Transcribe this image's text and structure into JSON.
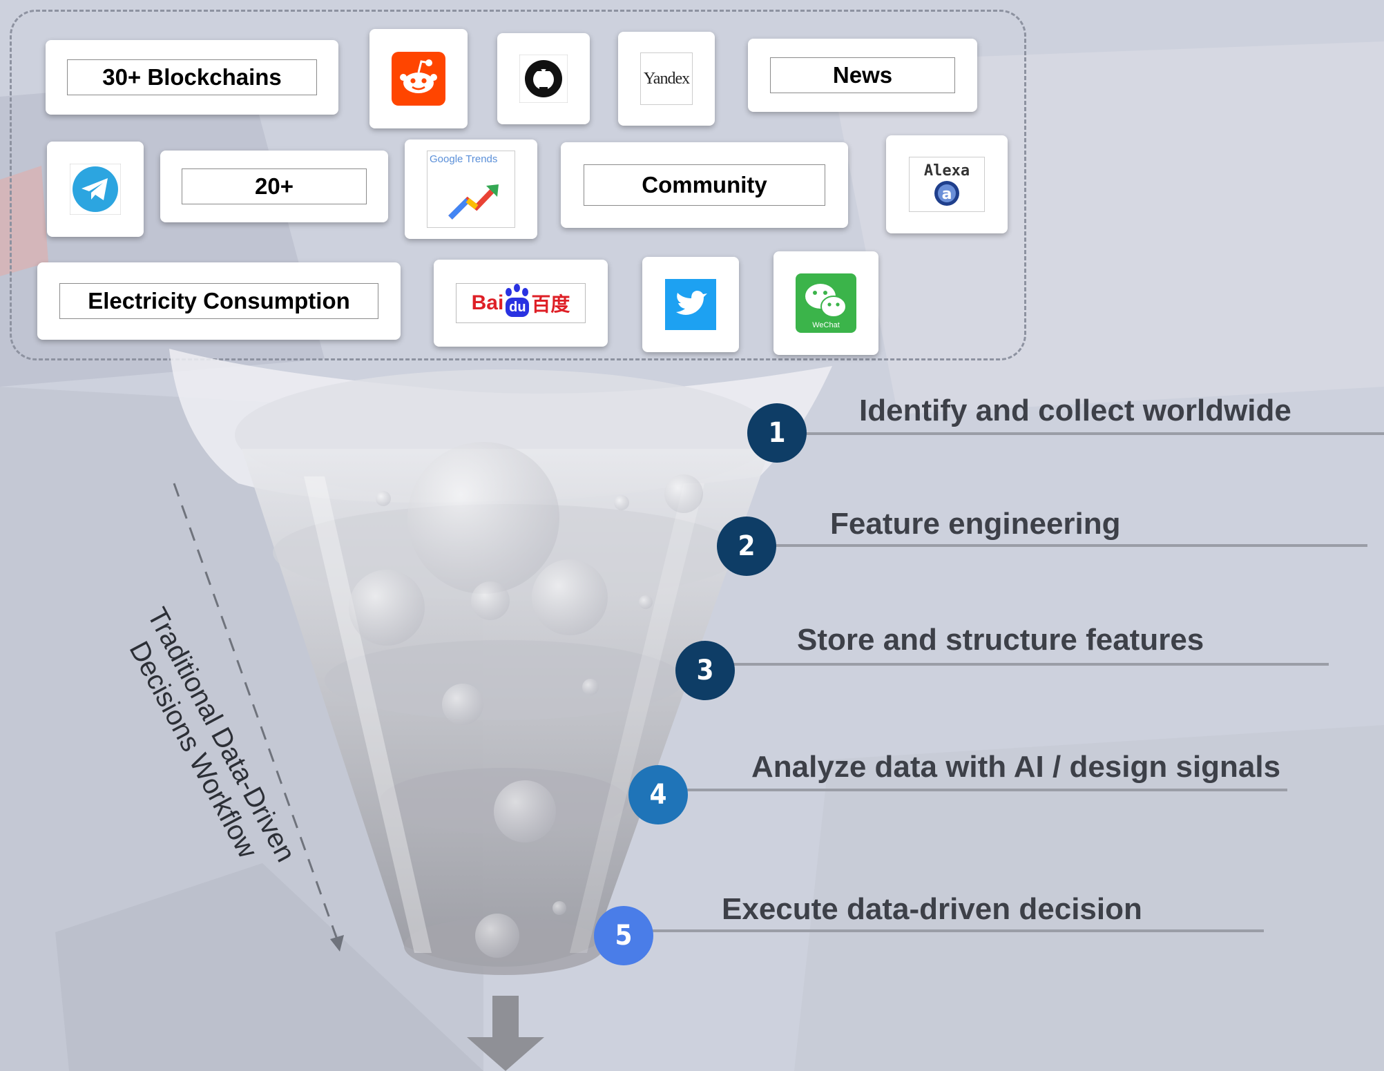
{
  "sources": {
    "blockchains": "30+ Blockchains",
    "news": "News",
    "more": "20+",
    "community": "Community",
    "electricity": "Electricity Consumption",
    "yandex": "Yandex",
    "alexa": "Alexa",
    "baidu_latin": "Bai",
    "baidu_du": "du",
    "baidu_cjk": "百度",
    "google_trends": "Google Trends",
    "wechat": "WeChat"
  },
  "steps": [
    {
      "number": "1",
      "label": "Identify and collect worldwide"
    },
    {
      "number": "2",
      "label": "Feature engineering"
    },
    {
      "number": "3",
      "label": "Store and structure features"
    },
    {
      "number": "4",
      "label": "Analyze data with AI / design signals"
    },
    {
      "number": "5",
      "label": "Execute data-driven decision"
    }
  ],
  "workflow_label": {
    "line1": "Traditional Data-Driven",
    "line2": "Decisions Workflow"
  },
  "colors": {
    "step1": "#0e3d66",
    "step2": "#0e3d66",
    "step3": "#0e3d66",
    "step4": "#1f74b8",
    "step5": "#4a7de8",
    "reddit": "#ff4500",
    "telegram": "#2ca5e0",
    "twitter": "#1da1f2",
    "wechat": "#3bb44a",
    "baidu_red": "#de1f26",
    "baidu_blue": "#2932e1"
  }
}
